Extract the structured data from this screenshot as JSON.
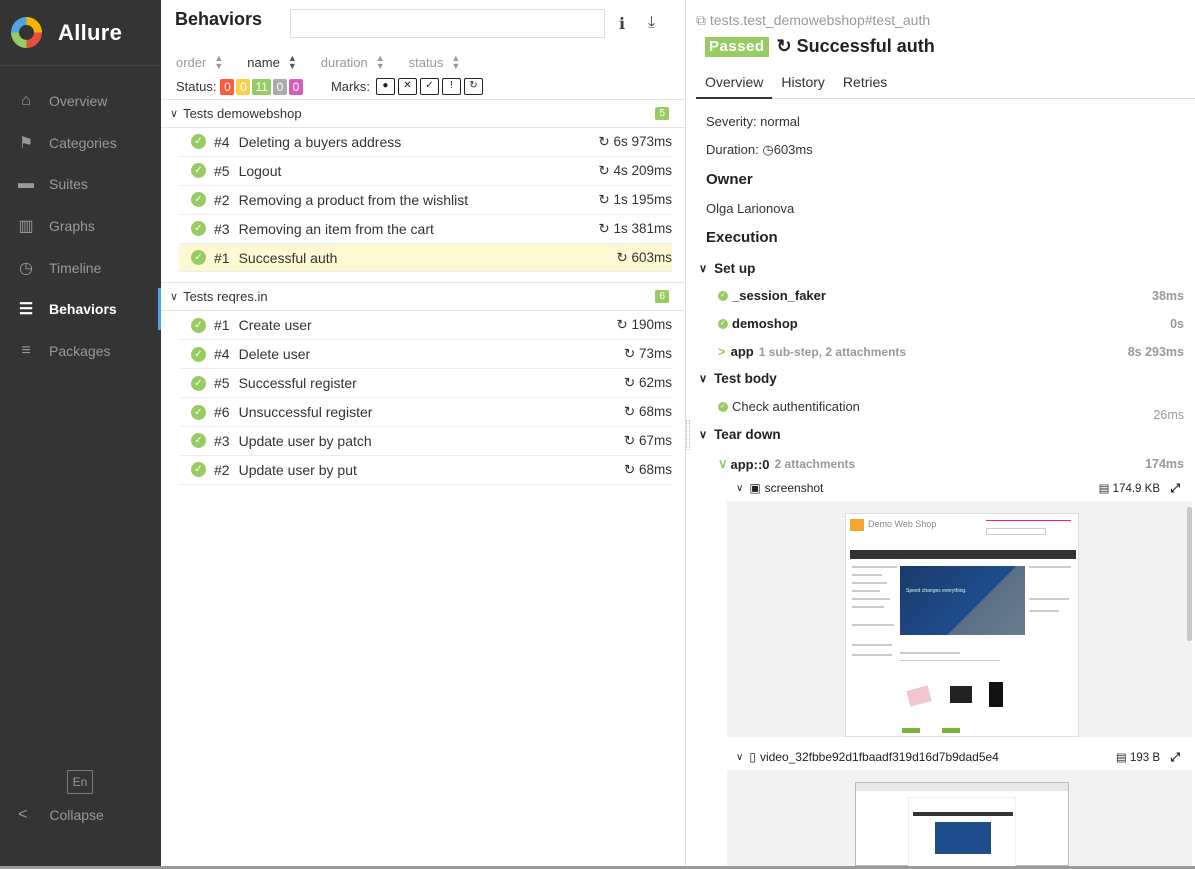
{
  "sidebar": {
    "brand": "Allure",
    "items": [
      {
        "label": "Overview",
        "icon": "home-icon",
        "glyph": "⌂"
      },
      {
        "label": "Categories",
        "icon": "flag-icon",
        "glyph": "⚑"
      },
      {
        "label": "Suites",
        "icon": "briefcase-icon",
        "glyph": "▬"
      },
      {
        "label": "Graphs",
        "icon": "bar-chart-icon",
        "glyph": "▥"
      },
      {
        "label": "Timeline",
        "icon": "clock-icon",
        "glyph": "◷"
      },
      {
        "label": "Behaviors",
        "icon": "list-icon",
        "glyph": "☰"
      },
      {
        "label": "Packages",
        "icon": "align-left-icon",
        "glyph": "≡"
      }
    ],
    "active": "Behaviors",
    "lang": "En",
    "collapse_label": "Collapse"
  },
  "middle": {
    "title": "Behaviors",
    "search_placeholder": "",
    "sort": {
      "order": "order",
      "name": "name",
      "duration": "duration",
      "status": "status"
    },
    "status_label": "Status:",
    "status_badges": [
      {
        "value": "0",
        "color": "#fd5a3e"
      },
      {
        "value": "0",
        "color": "#ffd050"
      },
      {
        "value": "11",
        "color": "#97cc64"
      },
      {
        "value": "0",
        "color": "#aaaaaa"
      },
      {
        "value": "0",
        "color": "#d35ebe"
      }
    ],
    "marks_label": "Marks:",
    "groups": [
      {
        "name": "Tests demowebshop",
        "count": "5",
        "tests": [
          {
            "num": "#4",
            "name": "Deleting a buyers address",
            "duration": "6s 973ms",
            "selected": false
          },
          {
            "num": "#5",
            "name": "Logout",
            "duration": "4s 209ms",
            "selected": false
          },
          {
            "num": "#2",
            "name": "Removing a product from the wishlist",
            "duration": "1s 195ms",
            "selected": false
          },
          {
            "num": "#3",
            "name": "Removing an item from the cart",
            "duration": "1s 381ms",
            "selected": false
          },
          {
            "num": "#1",
            "name": "Successful auth",
            "duration": "603ms",
            "selected": true
          }
        ]
      },
      {
        "name": "Tests reqres.in",
        "count": "6",
        "tests": [
          {
            "num": "#1",
            "name": "Create user",
            "duration": "190ms",
            "selected": false
          },
          {
            "num": "#4",
            "name": "Delete user",
            "duration": "73ms",
            "selected": false
          },
          {
            "num": "#5",
            "name": "Successful register",
            "duration": "62ms",
            "selected": false
          },
          {
            "num": "#6",
            "name": "Unsuccessful register",
            "duration": "68ms",
            "selected": false
          },
          {
            "num": "#3",
            "name": "Update user by patch",
            "duration": "67ms",
            "selected": false
          },
          {
            "num": "#2",
            "name": "Update user by put",
            "duration": "68ms",
            "selected": false
          }
        ]
      }
    ]
  },
  "right": {
    "full_name": "tests.test_demowebshop#test_auth",
    "status": "Passed",
    "title": "Successful auth",
    "tabs": [
      "Overview",
      "History",
      "Retries"
    ],
    "severity": "Severity: normal",
    "duration_label": "Duration:",
    "duration_value": "603ms",
    "owner_h": "Owner",
    "owner": "Olga Larionova",
    "execution_h": "Execution",
    "setup_h": "Set up",
    "setup_steps": [
      {
        "name": "_session_faker",
        "sub": "",
        "duration": "38ms"
      },
      {
        "name": "demoshop",
        "sub": "",
        "duration": "0s"
      },
      {
        "name": "app",
        "sub": "1 sub-step, 2 attachments",
        "duration": "8s 293ms"
      }
    ],
    "body_h": "Test body",
    "body_step": {
      "name": "Check authentification",
      "duration": "26ms"
    },
    "teardown_h": "Tear down",
    "teardown_step": {
      "name": "app::0",
      "sub": "2 attachments",
      "duration": "174ms"
    },
    "attachments": [
      {
        "name": "screenshot",
        "size": "174.9 KB"
      },
      {
        "name": "video_32fbbe92d1fbaadf319d16d7b9dad5e4",
        "size": "193 B"
      }
    ],
    "shop_title": "Demo Web Shop",
    "banner_text": "Speed changes everything."
  }
}
